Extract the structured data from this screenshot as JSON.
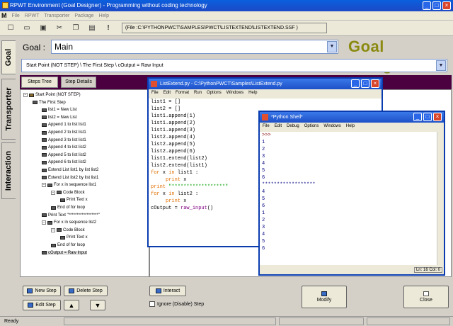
{
  "window": {
    "title": "RPWT Environment (Goal Designer) - Programming without coding technology"
  },
  "menu": [
    "File",
    "RPWT",
    "Transporter",
    "Package",
    "Help"
  ],
  "menu_logo": "M",
  "toolbar": {
    "path": "(File :C:\\PYTHONPWCT\\SAMPLES\\PWCT\\LISTEXTEND\\LISTEXTEND.SSF )"
  },
  "side_tabs": [
    "Goal",
    "Transporter",
    "Interaction"
  ],
  "goal": {
    "label": "Goal :",
    "value": "Main"
  },
  "brand": "Goal Designer",
  "breadcrumb": "Start Point (NOT STEP)  \\  The First Step  \\  cOutput = Raw Input",
  "tabs": [
    "Steps Tree",
    "Step Details"
  ],
  "tree": [
    "Start Point (NOT STEP)",
    "The First Step",
    "list1 = New List",
    "list2 = New List",
    "Append 1 to list list1",
    "Append 2 to list list1",
    "Append 3 to list list1",
    "Append 4 to list list2",
    "Append 5 to list list2",
    "Append 6 to list list2",
    "Extend List list1 by list list2",
    "Extend List list2 by list list1",
    "For x in sequence list1",
    "Code Block",
    "Print Text x",
    "End of for loop",
    "Print Text \"******************\"",
    "For x in sequence list2",
    "Code Block",
    "Print Text x",
    "End of for loop",
    "cOutput = Raw Input"
  ],
  "editor": {
    "title": "ListExtend.py - C:\\PythonPWCT\\Samples\\ListExtend.py",
    "menu": [
      "File",
      "Edit",
      "Format",
      "Run",
      "Options",
      "Windows",
      "Help"
    ],
    "lines": [
      {
        "t": "list1 = []",
        "k": "n"
      },
      {
        "t": "list2 = []",
        "k": "n"
      },
      {
        "t": "list1.append(1)",
        "k": "n"
      },
      {
        "t": "list1.append(2)",
        "k": "n"
      },
      {
        "t": "list1.append(3)",
        "k": "n"
      },
      {
        "t": "list2.append(4)",
        "k": "n"
      },
      {
        "t": "list2.append(5)",
        "k": "n"
      },
      {
        "t": "list2.append(6)",
        "k": "n"
      },
      {
        "t": "list1.extend(list2)",
        "k": "n"
      },
      {
        "t": "list2.extend(list1)",
        "k": "n"
      },
      {
        "t": "for x in list1 :",
        "k": "for"
      },
      {
        "t": "     print x",
        "k": "print"
      },
      {
        "t": "print \"******************\"",
        "k": "pstr"
      },
      {
        "t": "for x in list2 :",
        "k": "for"
      },
      {
        "t": "     print x",
        "k": "print"
      },
      {
        "t": "cOutput = raw_input()",
        "k": "raw"
      }
    ]
  },
  "shell": {
    "title": "*Python Shell*",
    "menu": [
      "File",
      "Edit",
      "Debug",
      "Options",
      "Windows",
      "Help"
    ],
    "lines": [
      ">>>",
      "1",
      "2",
      "3",
      "4",
      "5",
      "6",
      "******************",
      "4",
      "5",
      "6",
      "1",
      "2",
      "3",
      "4",
      "5",
      "6"
    ],
    "status": "Ln: 16 Col: 0"
  },
  "buttons": {
    "new_step": "New Step",
    "delete_step": "Delete Step",
    "edit_step": "Edit Step",
    "interact": "Interact",
    "ignore": "Ignore (Disable) Step",
    "modify": "Modify",
    "close": "Close",
    "up_icon": "up-arrow-icon",
    "down_icon": "down-arrow-icon"
  },
  "status": {
    "text": "Ready"
  }
}
